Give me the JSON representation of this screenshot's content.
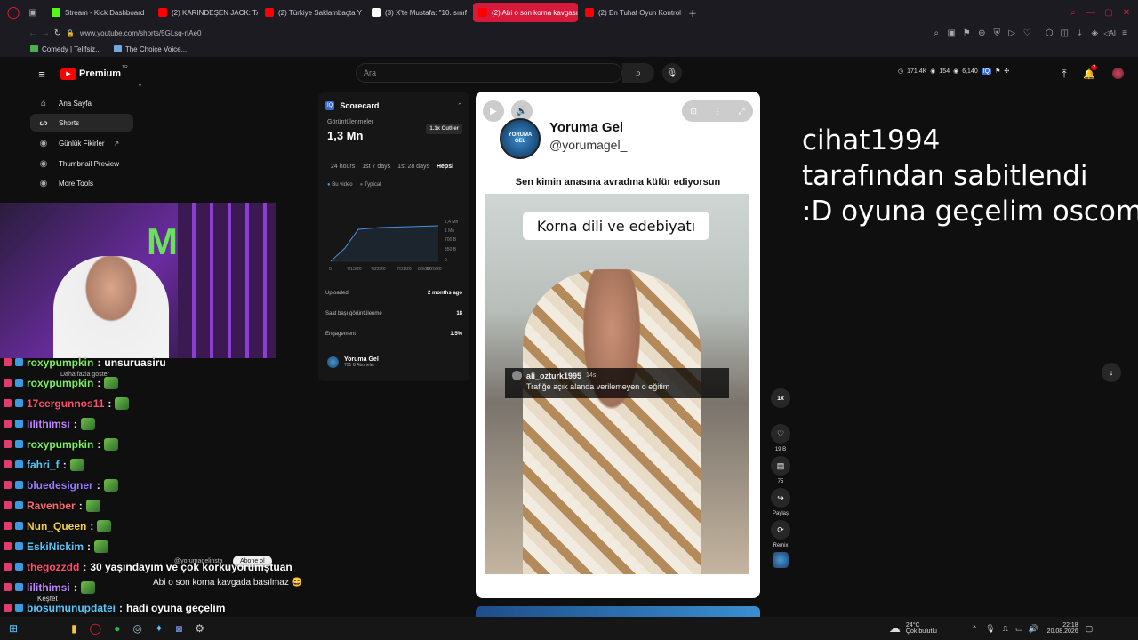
{
  "browser": {
    "tabs": [
      {
        "label": "Stream - Kick Dashboard",
        "color": "#53fc18",
        "active": false
      },
      {
        "label": "(2) KARINDEŞEN JACK: TA",
        "color": "#ff0000",
        "active": false
      },
      {
        "label": "(2) Türkiye Saklambaçta Y",
        "color": "#ff0000",
        "active": false
      },
      {
        "label": "(3) X'te Mustafa: \"10. sınıf",
        "color": "#ffffff",
        "active": false
      },
      {
        "label": "(2) Abi o son korna kavgası",
        "color": "#ff0000",
        "active": true
      },
      {
        "label": "(2) En Tuhaf Oyun Kontrol",
        "color": "#ff0000",
        "active": false
      }
    ],
    "url": "www.youtube.com/shorts/5GLsq-rIAe0",
    "bookmarks": [
      "Comedy | Telifsiz...",
      "The Choice Voice..."
    ]
  },
  "youtube": {
    "logo_text": "Premium",
    "logo_superscript": "TR",
    "search_placeholder": "Ara",
    "stats": {
      "views": "171.4K",
      "likes": "154",
      "watch": "6,140"
    },
    "notif_count": "2",
    "sidebar": [
      {
        "label": "Ana Sayfa",
        "icon": "home-icon"
      },
      {
        "label": "Shorts",
        "icon": "shorts-icon"
      },
      {
        "label": "Günlük Fikirler",
        "icon": "ideas-icon"
      },
      {
        "label": "Thumbnail Preview",
        "icon": "thumb-icon"
      },
      {
        "label": "More Tools",
        "icon": "tools-icon"
      }
    ]
  },
  "scorecard": {
    "title": "Scorecard",
    "views_label": "Görüntülenmeler",
    "views_value": "1,3 Mn",
    "outlier": "1.1x Outlier",
    "ranges": [
      "24 hours",
      "1st 7 days",
      "1st 28 days",
      "Hepsi"
    ],
    "legend": [
      "Bu video",
      "Typical"
    ],
    "y_ticks": [
      "1,4 Mn",
      "1 Mn",
      "700 B",
      "350 B",
      "0"
    ],
    "x_ticks": [
      "0",
      "7/13/26",
      "7/22/26",
      "7/31/26",
      "8/9/26",
      "8/20/26"
    ],
    "rows": [
      {
        "label": "Uploaded",
        "value": "2 months ago"
      },
      {
        "label": "Saat başı görüntülenme",
        "value": "18"
      },
      {
        "label": "Engagement",
        "value": "1.5%"
      }
    ],
    "channel_name": "Yoruma Gel",
    "channel_subs": "751 B Aboneler"
  },
  "short": {
    "channel_title": "Yoruma Gel",
    "channel_handle": "@yorumagel_",
    "headline": "Sen kimin anasına avradına küfür ediyorsun",
    "caption": "Korna dili ve edebiyatı",
    "comment_user": "ali_ozturk1995",
    "comment_time": "14s",
    "comment_text": "Trafiğe açık alanda verilemeyen o eğitim",
    "speed": "1x",
    "likes": "19 B",
    "comments": "75",
    "share": "Paylaş",
    "remix": "Remix"
  },
  "overlay_pin": [
    "cihat1994",
    "tarafından sabitlendi",
    ":D oyuna geçelim oscom"
  ],
  "faded": {
    "more": "Daha fazla göster",
    "sub_handle": "@yorumagelinsta",
    "subscribe": "Abone ol",
    "title": "Abi o son korna kavgada basılmaz 😄",
    "explore": "Keşfet"
  },
  "chat": [
    {
      "user": "roxypumpkin",
      "msg": "unsuruasiru",
      "color": "#7cf05a"
    },
    {
      "user": "roxypumpkin",
      "msg": "",
      "color": "#7cf05a"
    },
    {
      "user": "17cergunnos11",
      "msg": "",
      "color": "#ff4d6d"
    },
    {
      "user": "lilithimsi",
      "msg": "",
      "color": "#c084fc"
    },
    {
      "user": "roxypumpkin",
      "msg": "",
      "color": "#7cf05a"
    },
    {
      "user": "fahri_f",
      "msg": "",
      "color": "#5ac8fa"
    },
    {
      "user": "bluedesigner",
      "msg": "",
      "color": "#9b7bff"
    },
    {
      "user": "Ravenber",
      "msg": "",
      "color": "#ff6b6b"
    },
    {
      "user": "Nun_Queen",
      "msg": "",
      "color": "#f5d142"
    },
    {
      "user": "EskiNickim",
      "msg": "",
      "color": "#5ac8fa"
    },
    {
      "user": "thegozzdd",
      "msg": "30 yaşındayım ve çok korkuyorumştuan",
      "color": "#ff4d6d"
    },
    {
      "user": "lilithimsi",
      "msg": "",
      "color": "#c084fc"
    },
    {
      "user": "biosumunupdatei",
      "msg": "hadi oyuna geçelim",
      "color": "#5ac8fa"
    },
    {
      "user": "Ravenber",
      "msg": "",
      "color": "#ff6b6b"
    }
  ],
  "taskbar": {
    "weather_temp": "24°C",
    "weather_text": "Çok bulutlu",
    "time": "22:18",
    "date": "20.08.2026"
  }
}
